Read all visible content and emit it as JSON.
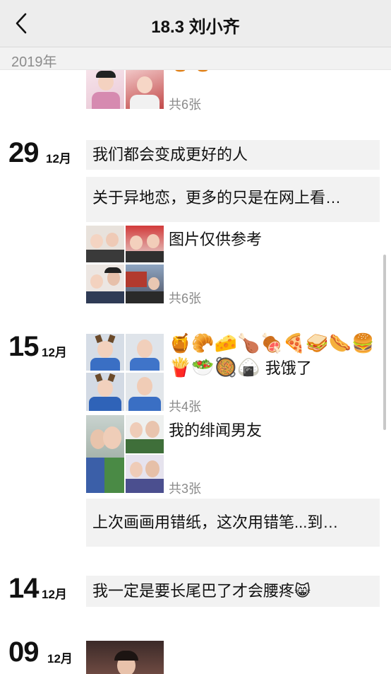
{
  "header": {
    "title": "18.3 刘小齐",
    "back_icon": "chevron-left-icon"
  },
  "year_label": "2019年",
  "top_partial": {
    "count": "共6张",
    "emoji_row": "🍯🍯"
  },
  "entries": [
    {
      "day": "29",
      "month": "12月",
      "text_posts": [
        "我们都会变成更好的人",
        "关于异地恋，更多的只是在网上看…"
      ],
      "photo_post": {
        "caption": "图片仅供参考",
        "count": "共6张"
      }
    },
    {
      "day": "15",
      "month": "12月",
      "emoji_post": {
        "emojis": "🍯🥐🧀🍗🍖🍕🥪🌭🍔🍟🥗🥘🍙",
        "text": "我饿了",
        "count": "共4张"
      },
      "photo_post": {
        "caption": "我的绯闻男友",
        "count": "共3张"
      },
      "text_posts": [
        "上次画画用错纸，这次用错笔...到…"
      ]
    },
    {
      "day": "14",
      "month": "12月",
      "text_posts": [
        "我一定是要长尾巴了才会腰疼😸"
      ]
    },
    {
      "day": "09",
      "month": "12月"
    }
  ],
  "colors": {
    "nav_bg": "#ededed",
    "card_bg": "#f2f2f2",
    "count_text": "#8a8a8a"
  }
}
